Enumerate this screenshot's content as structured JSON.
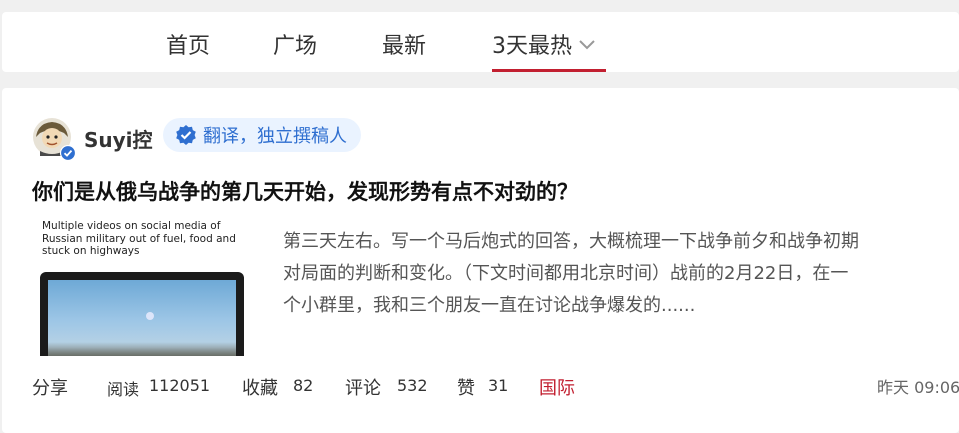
{
  "nav": {
    "tabs": [
      {
        "label": "首页"
      },
      {
        "label": "广场"
      },
      {
        "label": "最新"
      },
      {
        "label": "3天最热"
      }
    ],
    "active_tab": "3天最热",
    "accent_color": "#c21f30"
  },
  "post": {
    "author": {
      "name": "Suyi控",
      "verified_icon": "verified-check-icon",
      "badge": "翻译，独立撰稿人"
    },
    "title": "你们是从俄乌战争的第几天开始，发现形势有点不对劲的？",
    "thumbnail": {
      "caption": "Multiple videos on social media of Russian military out of fuel, food and stuck on highways"
    },
    "excerpt_lines": [
      "第三天左右。写一个马后炮式的回答，大概梳理一下战争前夕和战争初期",
      "对局面的判断和变化。（下文时间都用北京时间）战前的2月22日，在一",
      "个小群里，我和三个朋友一直在讨论战争爆发的......"
    ],
    "footer": {
      "share": "分享",
      "reads_label": "阅读",
      "reads": "112051",
      "favorites_label": "收藏",
      "favorites": "82",
      "comments_label": "评论",
      "comments": "532",
      "likes_label": "赞",
      "likes": "31",
      "tag": "国际",
      "time": "昨天 09:06"
    }
  }
}
